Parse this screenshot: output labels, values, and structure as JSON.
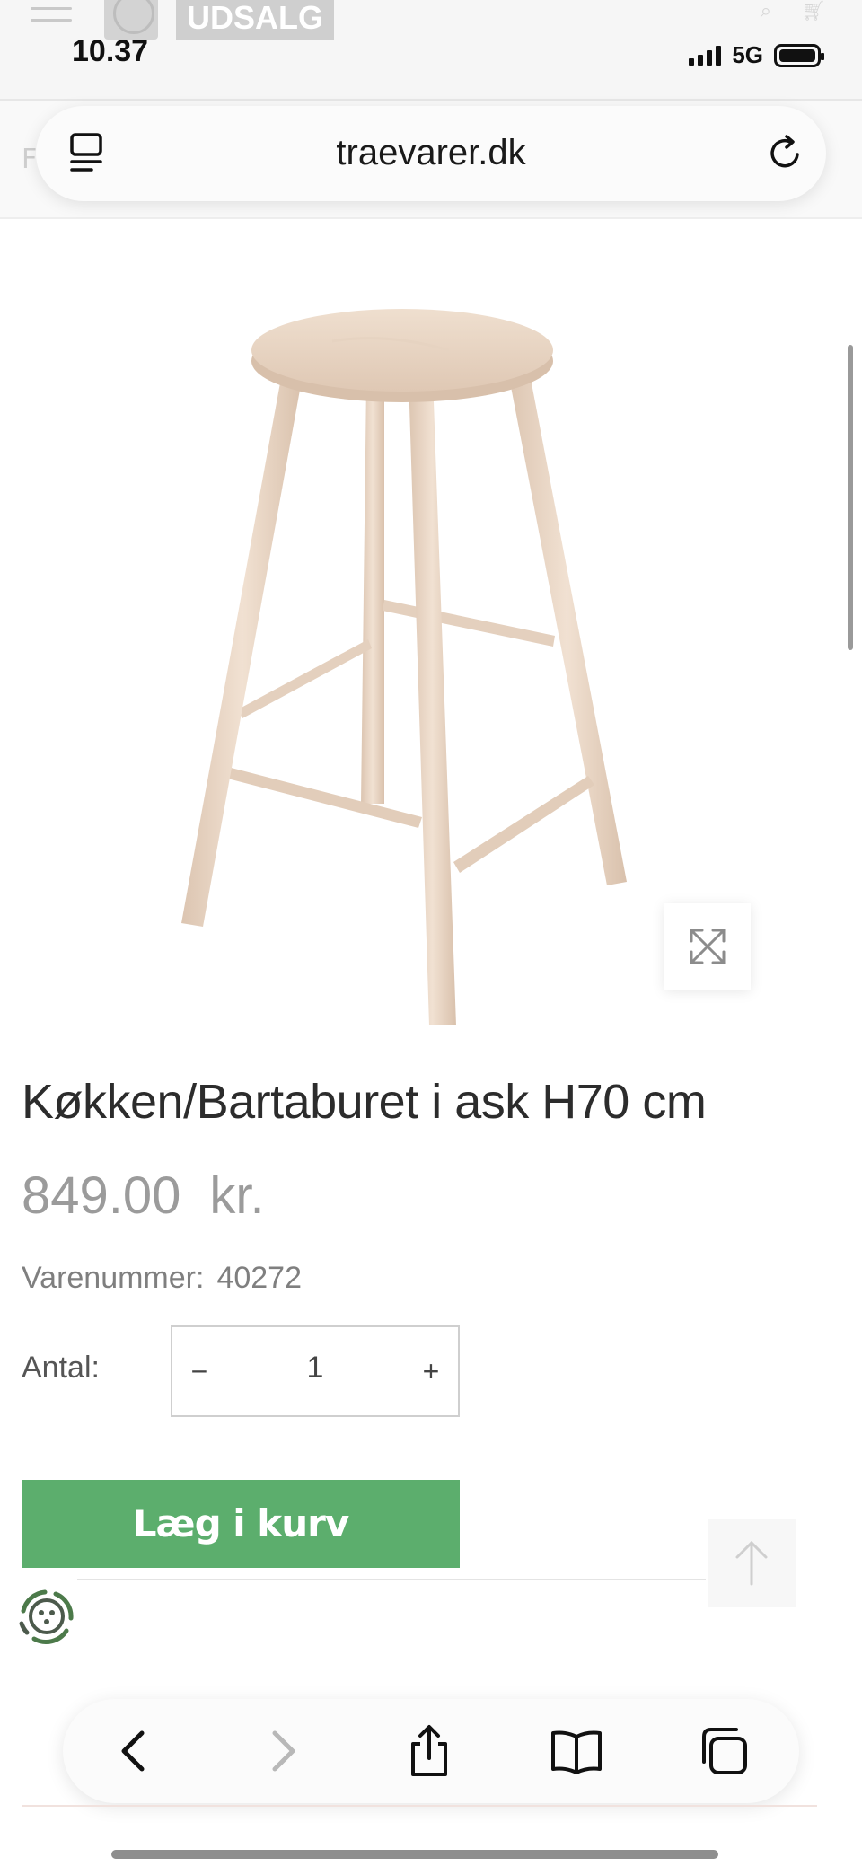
{
  "status_bar": {
    "time": "10.37",
    "network": "5G"
  },
  "site_header": {
    "sale_badge": "UDSALG"
  },
  "browser": {
    "url": "traevarer.dk"
  },
  "product": {
    "title": "Køkken/Bartaburet i ask H70 cm",
    "price_amount": "849.00",
    "price_currency": "kr.",
    "sku_label": "Varenummer:",
    "sku_value": "40272",
    "quantity_label": "Antal:",
    "quantity_minus": "−",
    "quantity_value": "1",
    "quantity_plus": "+",
    "add_to_cart_label": "Læg i kurv"
  },
  "colors": {
    "add_to_cart": "#5cae6d",
    "price": "#9b9b9b",
    "wood": "#e9d6c4"
  },
  "icons": {
    "reader": "reader-icon",
    "reload": "reload-icon",
    "zoom": "expand-icon",
    "scroll_top": "arrow-up-icon",
    "eco": "recycle-badge-icon",
    "toolbar": [
      "chevron-left-icon",
      "chevron-right-icon",
      "share-icon",
      "book-icon",
      "tabs-icon"
    ]
  }
}
